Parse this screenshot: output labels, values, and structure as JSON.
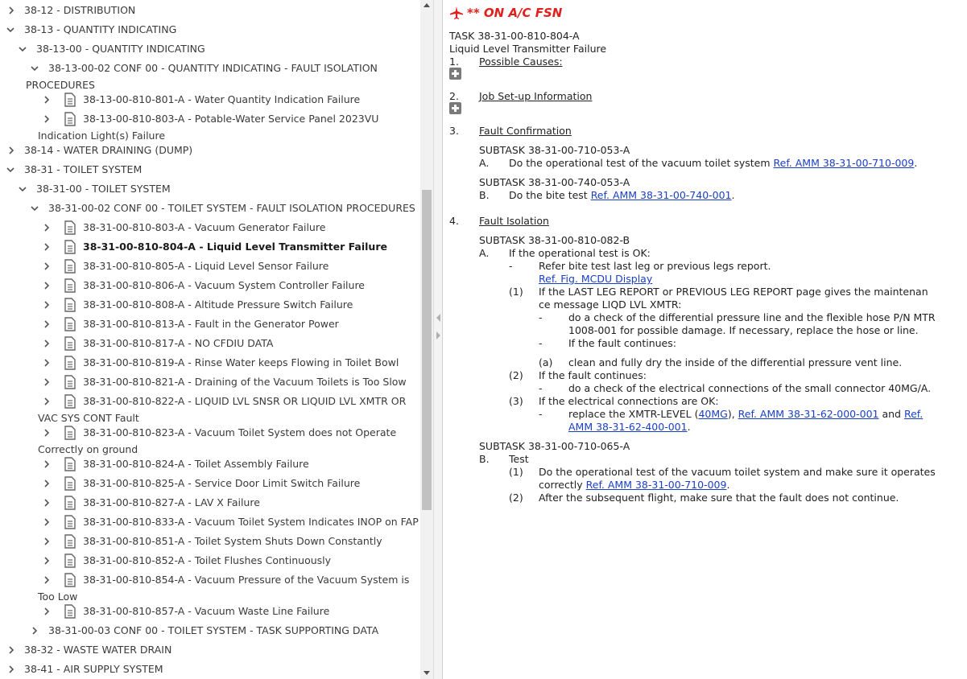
{
  "tree": {
    "items": [
      {
        "label": "38-12 - DISTRIBUTION",
        "state": "collapsed"
      },
      {
        "label": "38-13 - QUANTITY INDICATING",
        "state": "expanded"
      },
      {
        "label": "38-13-00 - QUANTITY INDICATING",
        "state": "expanded"
      },
      {
        "label": "38-13-00-02 CONF 00 - QUANTITY INDICATING - FAULT ISOLATION",
        "label2": "PROCEDURES",
        "state": "expanded"
      },
      {
        "label": "38-13-00-810-801-A - Water Quantity Indication Failure",
        "state": "collapsed"
      },
      {
        "label": "38-13-00-810-803-A - Potable-Water Service Panel 2023VU",
        "label2": "Indication Light(s) Failure",
        "state": "collapsed"
      },
      {
        "label": "38-14 - WATER DRAINING (DUMP)",
        "state": "collapsed"
      },
      {
        "label": "38-31 - TOILET SYSTEM",
        "state": "expanded"
      },
      {
        "label": "38-31-00 - TOILET SYSTEM",
        "state": "expanded"
      },
      {
        "label": "38-31-00-02 CONF 00 - TOILET SYSTEM - FAULT ISOLATION PROCEDURES",
        "state": "expanded"
      },
      {
        "label": "38-31-00-810-803-A - Vacuum Generator Failure",
        "state": "collapsed"
      },
      {
        "label": "38-31-00-810-804-A - Liquid Level Transmitter Failure",
        "state": "collapsed",
        "selected": true
      },
      {
        "label": "38-31-00-810-805-A - Liquid Level Sensor Failure",
        "state": "collapsed"
      },
      {
        "label": "38-31-00-810-806-A - Vacuum System Controller Failure",
        "state": "collapsed"
      },
      {
        "label": "38-31-00-810-808-A - Altitude Pressure Switch Failure",
        "state": "collapsed"
      },
      {
        "label": "38-31-00-810-813-A - Fault in the Generator Power",
        "state": "collapsed"
      },
      {
        "label": "38-31-00-810-817-A - NO CFDIU DATA",
        "state": "collapsed"
      },
      {
        "label": "38-31-00-810-819-A - Rinse Water keeps Flowing in Toilet Bowl",
        "state": "collapsed"
      },
      {
        "label": "38-31-00-810-821-A - Draining of the Vacuum Toilets is Too Slow",
        "state": "collapsed"
      },
      {
        "label": "38-31-00-810-822-A - LIQUID LVL SNSR OR LIQUID LVL XMTR OR",
        "label2": "VAC SYS CONT Fault",
        "state": "collapsed"
      },
      {
        "label": "38-31-00-810-823-A - Vacuum Toilet System does not Operate",
        "label2": "Correctly on ground",
        "state": "collapsed"
      },
      {
        "label": "38-31-00-810-824-A - Toilet Assembly Failure",
        "state": "collapsed"
      },
      {
        "label": "38-31-00-810-825-A - Service Door Limit Switch Failure",
        "state": "collapsed"
      },
      {
        "label": "38-31-00-810-827-A - LAV X Failure",
        "state": "collapsed"
      },
      {
        "label": "38-31-00-810-833-A - Vacuum Toilet System Indicates INOP on FAP",
        "state": "collapsed"
      },
      {
        "label": "38-31-00-810-851-A - Toilet System Shuts Down Constantly",
        "state": "collapsed"
      },
      {
        "label": "38-31-00-810-852-A - Toilet Flushes Continuously",
        "state": "collapsed"
      },
      {
        "label": "38-31-00-810-854-A - Vacuum Pressure of the Vacuum System is",
        "label2": "Too Low",
        "state": "collapsed"
      },
      {
        "label": "38-31-00-810-857-A - Vacuum Waste Line Failure",
        "state": "collapsed"
      },
      {
        "label": "38-31-00-03 CONF 00 - TOILET SYSTEM - TASK SUPPORTING DATA",
        "state": "collapsed"
      },
      {
        "label": "38-32 - WASTE WATER DRAIN",
        "state": "collapsed"
      },
      {
        "label": "38-41 - AIR SUPPLY SYSTEM",
        "state": "collapsed"
      }
    ]
  },
  "content": {
    "fsn_label": "** ON A/C FSN",
    "task_id": "TASK 38-31-00-810-804-A",
    "task_title": "Liquid Level Transmitter Failure",
    "s1_num": "1.",
    "s1_title": "Possible Causes:",
    "s2_num": "2.",
    "s2_title": "Job Set-up Information",
    "s3_num": "3.",
    "s3_title": "Fault Confirmation",
    "s3_sub1": "SUBTASK 38-31-00-710-053-A",
    "s3_a_letter": "A.",
    "s3_a_text": "Do the operational test of the vacuum toilet system ",
    "s3_a_link": "Ref. AMM 38-31-00-710-009",
    "s3_a_end": ".",
    "s3_sub2": "SUBTASK 38-31-00-740-053-A",
    "s3_b_letter": "B.",
    "s3_b_text": "Do the bite test ",
    "s3_b_link": "Ref. AMM 38-31-00-740-001",
    "s3_b_end": ".",
    "s4_num": "4.",
    "s4_title": "Fault Isolation",
    "s4_sub1": "SUBTASK 38-31-00-810-082-B",
    "s4_a_letter": "A.",
    "s4_a_text": "If the operational test is OK:",
    "dash": "-",
    "s4_a_dash1": "Refer bite test last leg or previous legs report.",
    "s4_a_fig_link": "Ref. Fig. MCDU Display",
    "s4_1_num": "(1)",
    "s4_1_line1": "If the LAST LEG REPORT or PREVIOUS LEG REPORT page gives the maintenan",
    "s4_1_line2": "ce message LIQD LVL XMTR:",
    "s4_1_d1_line1": "do a check of the differential pressure line and the flexible hose P/N MTR",
    "s4_1_d1_line2": "1008-001 for possible damage. If necessary, replace the hose or line.",
    "s4_1_d2": "If the fault continues:",
    "s4_1_a_num": "(a)",
    "s4_1_a_text": "clean and fully dry the inside of the differential pressure vent line.",
    "s4_2_num": "(2)",
    "s4_2_text": "If the fault continues:",
    "s4_2_d1": "do a check of the electrical connections of the small connector 40MG/A.",
    "s4_3_num": "(3)",
    "s4_3_text": "If the electrical connections are OK:",
    "s4_3_d1_pre": "replace the XMTR-LEVEL (",
    "s4_3_d1_link1": "40MG",
    "s4_3_d1_mid": "), ",
    "s4_3_d1_link2": "Ref. AMM 38-31-62-000-001",
    "s4_3_d1_and": " and ",
    "s4_3_d1_link3a": "Ref.",
    "s4_3_d1_link3b": "AMM 38-31-62-400-001",
    "s4_3_d1_end": ".",
    "s4_sub2": "SUBTASK 38-31-00-710-065-A",
    "s4_b_letter": "B.",
    "s4_b_text": "Test",
    "s4_b1_num": "(1)",
    "s4_b1_line1": "Do the operational test of the vacuum toilet system and make sure it operates",
    "s4_b1_line2": "correctly ",
    "s4_b1_link": "Ref. AMM 38-31-00-710-009",
    "s4_b1_end": ".",
    "s4_b2_num": "(2)",
    "s4_b2_text": "After the subsequent flight, make sure that the fault does not continue."
  },
  "colors": {
    "accent_red": "#e0201c",
    "link_blue": "#1a3fc4",
    "text": "#222222"
  },
  "icons": {
    "tree_doc": "document-icon",
    "expand": "chevron-right-icon",
    "collapse": "chevron-down-icon",
    "fsn": "airplane-icon",
    "section": "plus-box-icon"
  }
}
